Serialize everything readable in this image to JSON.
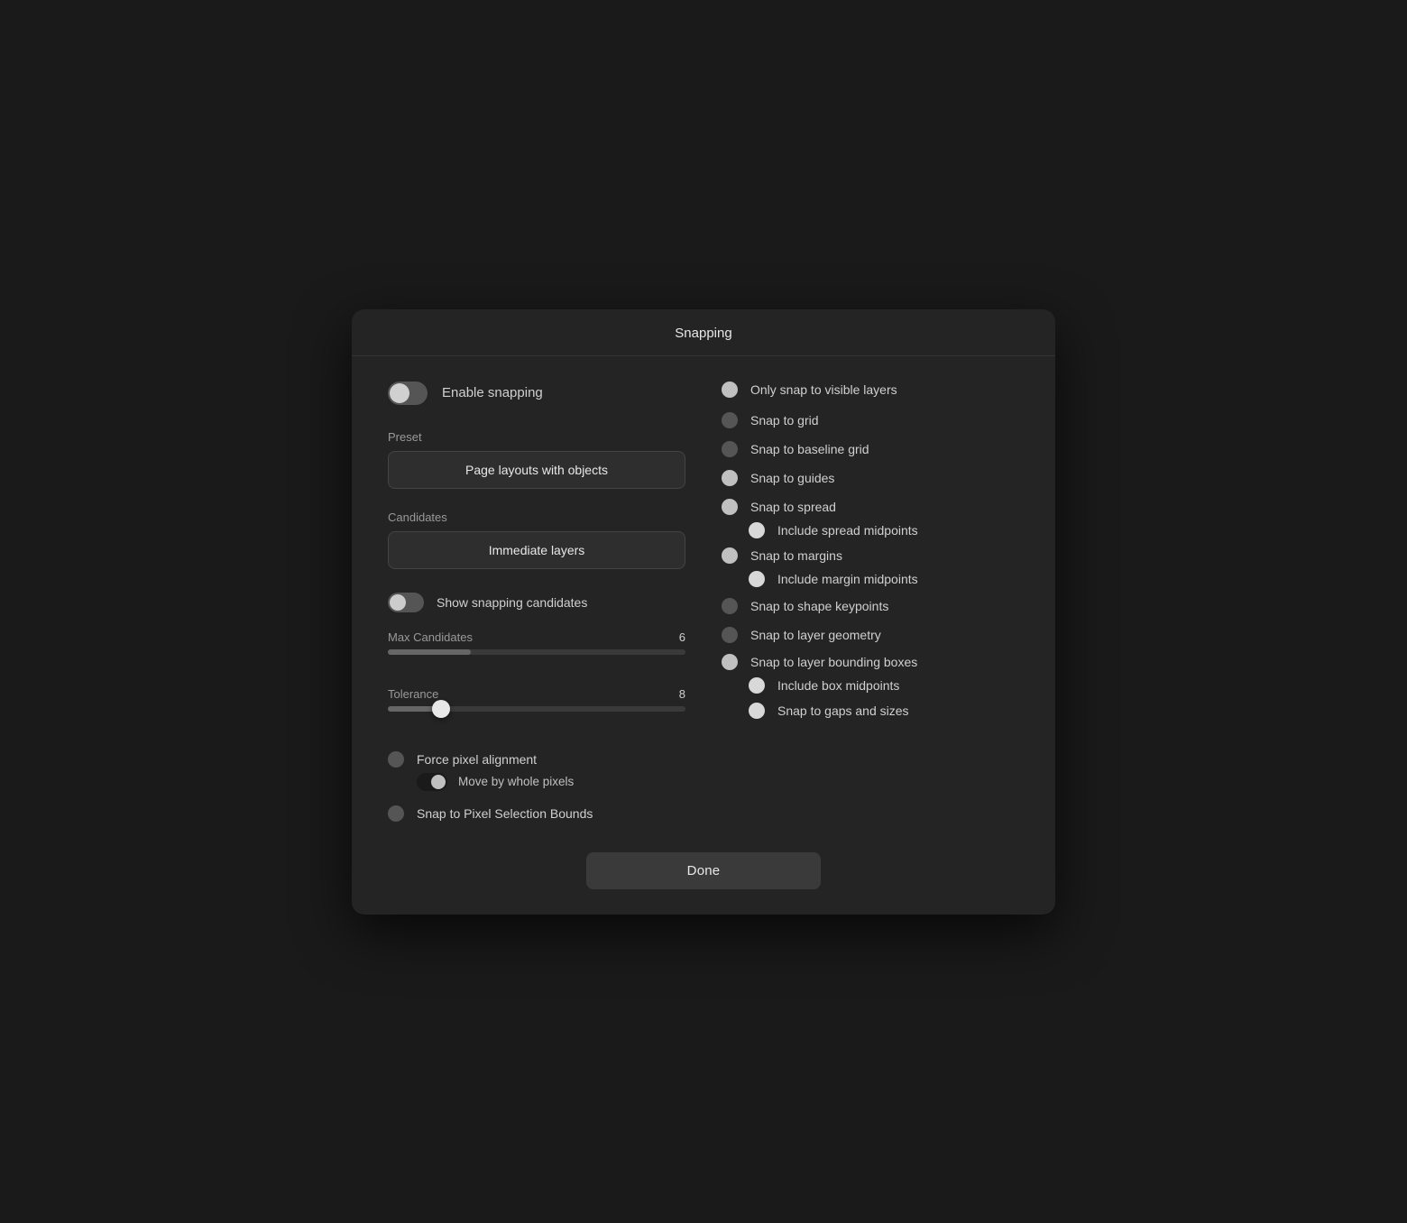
{
  "dialog": {
    "title": "Snapping"
  },
  "left": {
    "enable_snapping_label": "Enable snapping",
    "preset_section_label": "Preset",
    "preset_btn_label": "Page layouts with objects",
    "candidates_section_label": "Candidates",
    "candidates_btn_label": "Immediate layers",
    "show_candidates_label": "Show snapping candidates",
    "max_candidates_label": "Max Candidates",
    "max_candidates_value": "6",
    "tolerance_label": "Tolerance",
    "tolerance_value": "8",
    "force_pixel_label": "Force pixel alignment",
    "move_whole_pixels_label": "Move by whole pixels",
    "snap_pixel_selection_label": "Snap to Pixel Selection Bounds"
  },
  "right": {
    "only_visible_label": "Only snap to visible layers",
    "snap_grid_label": "Snap to grid",
    "snap_baseline_label": "Snap to baseline grid",
    "snap_guides_label": "Snap to guides",
    "snap_spread_label": "Snap to spread",
    "include_spread_midpoints_label": "Include spread midpoints",
    "snap_margins_label": "Snap to margins",
    "include_margin_midpoints_label": "Include margin midpoints",
    "snap_shape_keypoints_label": "Snap to shape keypoints",
    "snap_layer_geometry_label": "Snap to layer geometry",
    "snap_layer_bounding_label": "Snap to layer bounding boxes",
    "include_box_midpoints_label": "Include box midpoints",
    "snap_gaps_label": "Snap to gaps and sizes"
  },
  "footer": {
    "done_label": "Done"
  }
}
